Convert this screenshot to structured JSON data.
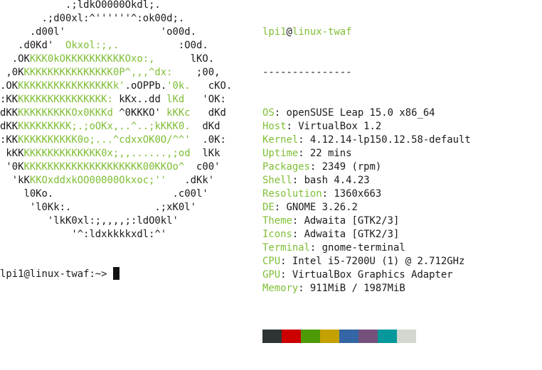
{
  "logo": {
    "lines": [
      [
        {
          "t": "           .;ldkO0000Okdl;.",
          "c": "k"
        }
      ],
      [
        {
          "t": "       .;d00xl:^''''''^:ok00d;.",
          "c": "k"
        }
      ],
      [
        {
          "t": "     .d00l'                'o00d.",
          "c": "k"
        }
      ],
      [
        {
          "t": "   .d0Kd'  ",
          "c": "k"
        },
        {
          "t": "Okxol:;,.",
          "c": "g"
        },
        {
          "t": "          :O0d.",
          "c": "k"
        }
      ],
      [
        {
          "t": "  .OK",
          "c": "k"
        },
        {
          "t": "KKK0kOKKKKKKKKKKOxo:,",
          "c": "g"
        },
        {
          "t": "      lKO.",
          "c": "k"
        }
      ],
      [
        {
          "t": " ,0K",
          "c": "k"
        },
        {
          "t": "KKKKKKKKKKKKKKK0P^,,,^dx:",
          "c": "g"
        },
        {
          "t": "    ;00,",
          "c": "k"
        }
      ],
      [
        {
          "t": ".OK",
          "c": "k"
        },
        {
          "t": "KKKKKKKKKKKKKKKKk'",
          "c": "g"
        },
        {
          "t": ".oOPPb.",
          "c": "k"
        },
        {
          "t": "'0k.",
          "c": "g"
        },
        {
          "t": "   cKO.",
          "c": "k"
        }
      ],
      [
        {
          "t": ":KK",
          "c": "k"
        },
        {
          "t": "KKKKKKKKKKKKKKK: ",
          "c": "g"
        },
        {
          "t": "kKx..dd ",
          "c": "k"
        },
        {
          "t": "lKd",
          "c": "g"
        },
        {
          "t": "   'OK:",
          "c": "k"
        }
      ],
      [
        {
          "t": "dKK",
          "c": "k"
        },
        {
          "t": "KKKKKKKKKOx0KKKd ",
          "c": "g"
        },
        {
          "t": "^0KKKO' ",
          "c": "k"
        },
        {
          "t": "kKKc",
          "c": "g"
        },
        {
          "t": "   dKd",
          "c": "k"
        }
      ],
      [
        {
          "t": "dKK",
          "c": "k"
        },
        {
          "t": "KKKKKKKKK;.;oOKx,..^..;kKKK0.",
          "c": "g"
        },
        {
          "t": "  dKd",
          "c": "k"
        }
      ],
      [
        {
          "t": ":KK",
          "c": "k"
        },
        {
          "t": "KKKKKKKKKK0o;...^cdxxOK0O/^^'",
          "c": "g"
        },
        {
          "t": "  .0K:",
          "c": "k"
        }
      ],
      [
        {
          "t": " kKK",
          "c": "k"
        },
        {
          "t": "KKKKKKKKKKKKK0x;,,......,;od",
          "c": "g"
        },
        {
          "t": "  lKk",
          "c": "k"
        }
      ],
      [
        {
          "t": " '0K",
          "c": "k"
        },
        {
          "t": "KKKKKKKKKKKKKKKKKKKK00KKOo^",
          "c": "g"
        },
        {
          "t": "  c00'",
          "c": "k"
        }
      ],
      [
        {
          "t": "  'kK",
          "c": "k"
        },
        {
          "t": "KKOxddxkOO00000Okxoc;''",
          "c": "g"
        },
        {
          "t": "   .dKk'",
          "c": "k"
        }
      ],
      [
        {
          "t": "    l0Ko.                    .c00l'",
          "c": "k"
        }
      ],
      [
        {
          "t": "     'l0Kk:.              .;xK0l'",
          "c": "k"
        }
      ],
      [
        {
          "t": "        'lkK0xl:;,,,,;:ldO0kl'",
          "c": "k"
        }
      ],
      [
        {
          "t": "            '^:ldxkkkkxdl:^'",
          "c": "k"
        }
      ]
    ]
  },
  "header": {
    "user": "lpi1",
    "at": "@",
    "host": "linux-twaf",
    "separator": "---------------"
  },
  "info": [
    {
      "key": "OS",
      "value": "openSUSE Leap 15.0 x86_64"
    },
    {
      "key": "Host",
      "value": "VirtualBox 1.2"
    },
    {
      "key": "Kernel",
      "value": "4.12.14-lp150.12.58-default"
    },
    {
      "key": "Uptime",
      "value": "22 mins"
    },
    {
      "key": "Packages",
      "value": "2349 (rpm)"
    },
    {
      "key": "Shell",
      "value": "bash 4.4.23"
    },
    {
      "key": "Resolution",
      "value": "1360x663"
    },
    {
      "key": "DE",
      "value": "GNOME 3.26.2"
    },
    {
      "key": "Theme",
      "value": "Adwaita [GTK2/3]"
    },
    {
      "key": "Icons",
      "value": "Adwaita [GTK2/3]"
    },
    {
      "key": "Terminal",
      "value": "gnome-terminal"
    },
    {
      "key": "CPU",
      "value": "Intel i5-7200U (1) @ 2.712GHz"
    },
    {
      "key": "GPU",
      "value": "VirtualBox Graphics Adapter"
    },
    {
      "key": "Memory",
      "value": "911MiB / 1987MiB"
    }
  ],
  "colors": {
    "accent": "#7fbe35",
    "palette": [
      "#2e3436",
      "#cc0000",
      "#4e9a06",
      "#c4a000",
      "#3465a4",
      "#75507b",
      "#06989a",
      "#d3d7cf"
    ]
  },
  "prompt": {
    "text": "lpi1@linux-twaf:~> "
  }
}
